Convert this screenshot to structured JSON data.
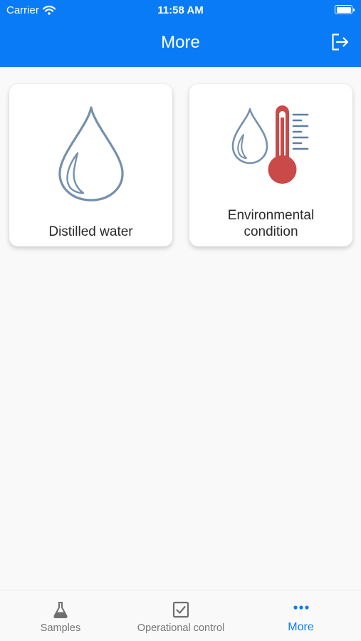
{
  "status_bar": {
    "carrier": "Carrier",
    "time": "11:58 AM"
  },
  "header": {
    "title": "More",
    "logout_icon": "logout-icon"
  },
  "tiles": [
    {
      "label": "Distilled water",
      "icon": "water-drop-icon"
    },
    {
      "label_line1": "Environmental",
      "label_line2": "condition",
      "icon": "thermometer-drop-icon"
    }
  ],
  "tabbar": {
    "tabs": [
      {
        "label": "Samples",
        "icon": "flask-icon",
        "active": false
      },
      {
        "label": "Operational control",
        "icon": "checkbox-icon",
        "active": false
      },
      {
        "label": "More",
        "icon": "more-dots-icon",
        "active": true
      }
    ]
  },
  "colors": {
    "primary": "#0a7bf6",
    "drop_stroke": "#7490ad",
    "thermo_red": "#c94a48",
    "scale_blue": "#5d7fa0",
    "inactive_tab": "#777777"
  }
}
